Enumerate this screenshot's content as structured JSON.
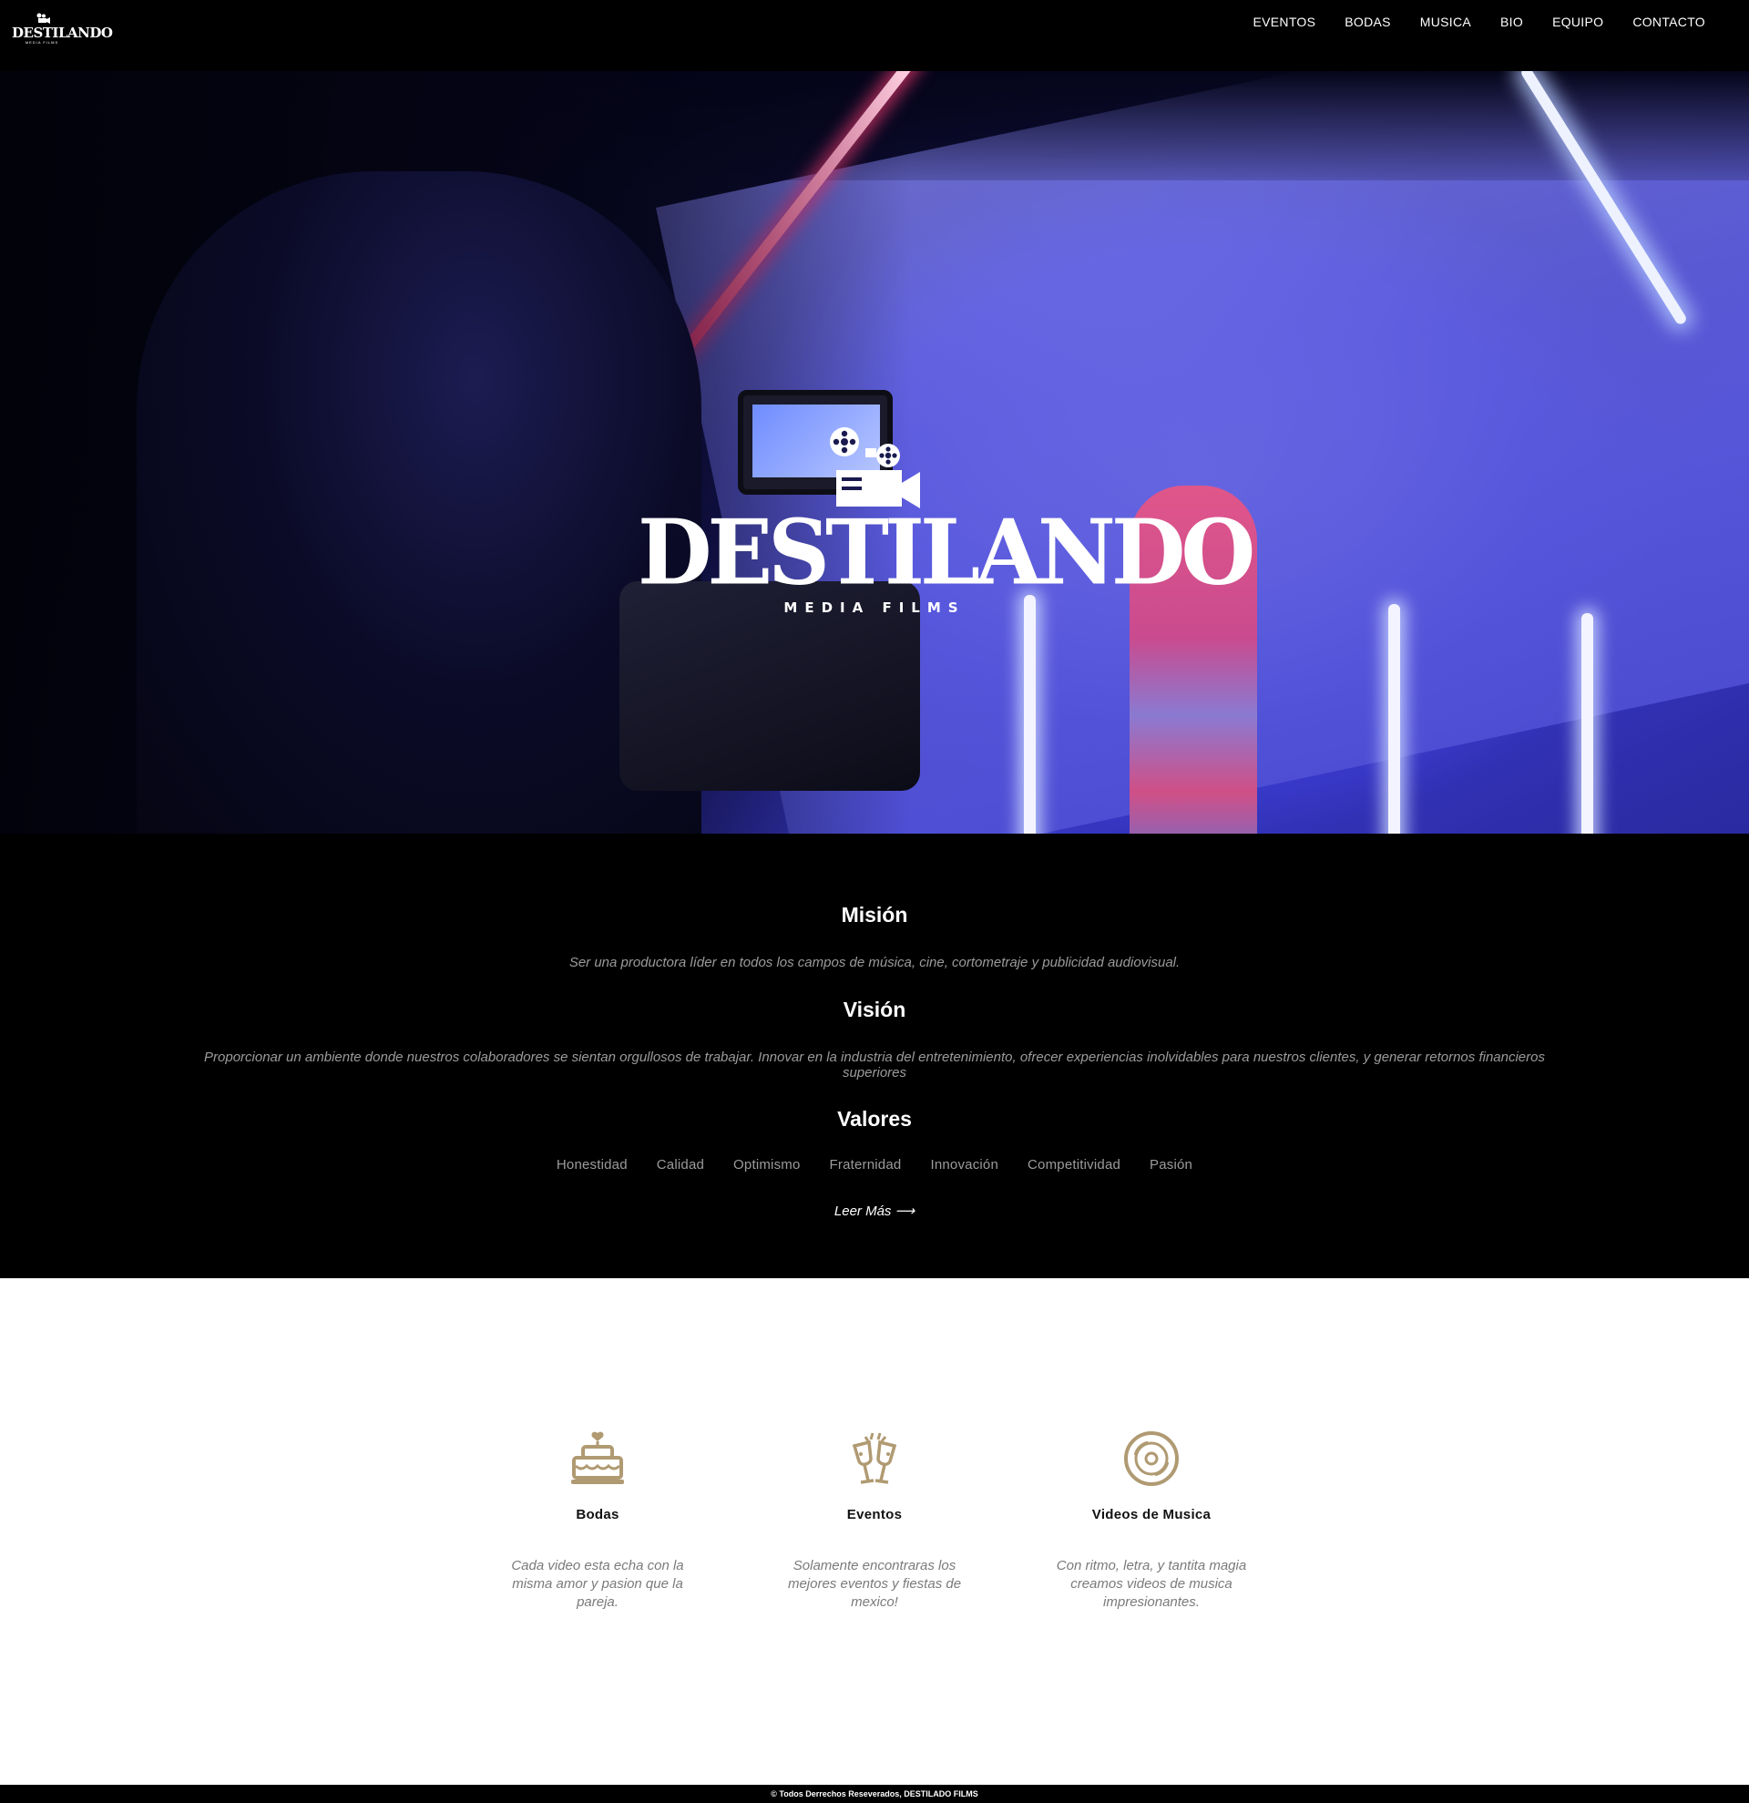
{
  "brand": {
    "name": "DESTILANDO",
    "subtitle": "MEDIA FILMS"
  },
  "nav": {
    "items": [
      {
        "label": "EVENTOS"
      },
      {
        "label": "BODAS"
      },
      {
        "label": "MUSICA"
      },
      {
        "label": "BIO"
      },
      {
        "label": "EQUIPO"
      },
      {
        "label": "CONTACTO"
      }
    ]
  },
  "about": {
    "mision_title": "Misión",
    "mision_text": "Ser una productora líder en todos los campos de música, cine, cortometraje y publicidad audiovisual.",
    "vision_title": "Visión",
    "vision_text": "Proporcionar un ambiente donde nuestros colaboradores se sientan orgullosos de trabajar. Innovar en la industria del entretenimiento, ofrecer experiencias inolvidables para nuestros clientes, y generar retornos financieros superiores",
    "valores_title": "Valores",
    "valores": [
      "Honestidad",
      "Calidad",
      "Optimismo",
      "Fraternidad",
      "Innovación",
      "Competitividad",
      "Pasión"
    ],
    "read_more": "Leer Más ⟶"
  },
  "services": [
    {
      "icon": "wedding-cake-icon",
      "title": "Bodas",
      "text": "Cada video esta echa con la misma amor y pasion que la pareja."
    },
    {
      "icon": "champagne-toast-icon",
      "title": "Eventos",
      "text": "Solamente encontraras los mejores eventos y fiestas de mexico!"
    },
    {
      "icon": "vinyl-disc-icon",
      "title": "Videos de Musica",
      "text": "Con ritmo, letra, y tantita magia creamos videos de musica impresionantes."
    }
  ],
  "footer": {
    "text": "© Todos Derrechos Reseverados, DESTILADO FILMS"
  },
  "colors": {
    "accent_gold": "#b09a72",
    "muted_text": "#9b9b9b",
    "background_dark": "#000000"
  }
}
